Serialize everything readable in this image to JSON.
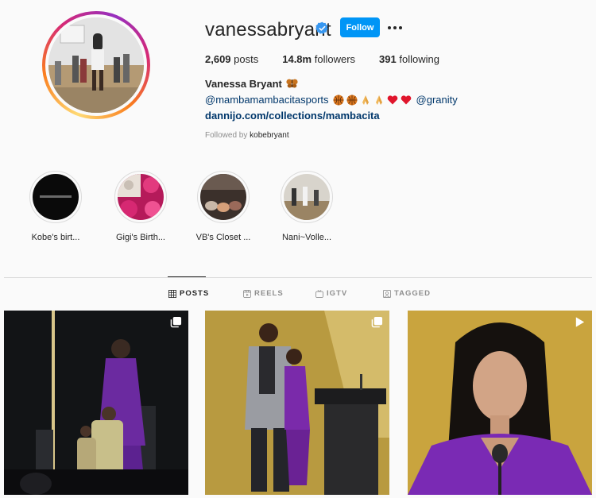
{
  "profile": {
    "username": "vanessabryant",
    "follow_label": "Follow",
    "stats": [
      {
        "count": "2,609",
        "label": " posts"
      },
      {
        "count": "14.8m",
        "label": " followers"
      },
      {
        "count": "391",
        "label": " following"
      }
    ],
    "full_name": "Vanessa Bryant",
    "bio_handle": "@mambamambacitasports",
    "bio_handle2": "@granity",
    "website": "dannijo.com/collections/mambacita",
    "followed_by_prefix": "Followed by ",
    "followed_by_user": "kobebryant"
  },
  "highlights": [
    {
      "label": "Kobe's birt...",
      "icon": "black-circle-text"
    },
    {
      "label": "Gigi's Birth...",
      "icon": "pink-roses"
    },
    {
      "label": "VB's Closet ...",
      "icon": "shoes"
    },
    {
      "label": "Nani~Volle...",
      "icon": "volleyball-court"
    }
  ],
  "tabs": [
    {
      "label": "POSTS",
      "icon": "grid-icon",
      "active": true
    },
    {
      "label": "REELS",
      "icon": "reels-icon",
      "active": false
    },
    {
      "label": "IGTV",
      "icon": "igtv-icon",
      "active": false
    },
    {
      "label": "TAGGED",
      "icon": "tagged-icon",
      "active": false
    }
  ],
  "posts": [
    {
      "badge": "carousel-icon"
    },
    {
      "badge": "carousel-icon"
    },
    {
      "badge": "video-icon"
    }
  ],
  "colors": {
    "accent": "#0095f6",
    "link": "#00376b",
    "muted": "#8e8e8e",
    "text": "#262626",
    "background": "#fafafa"
  }
}
